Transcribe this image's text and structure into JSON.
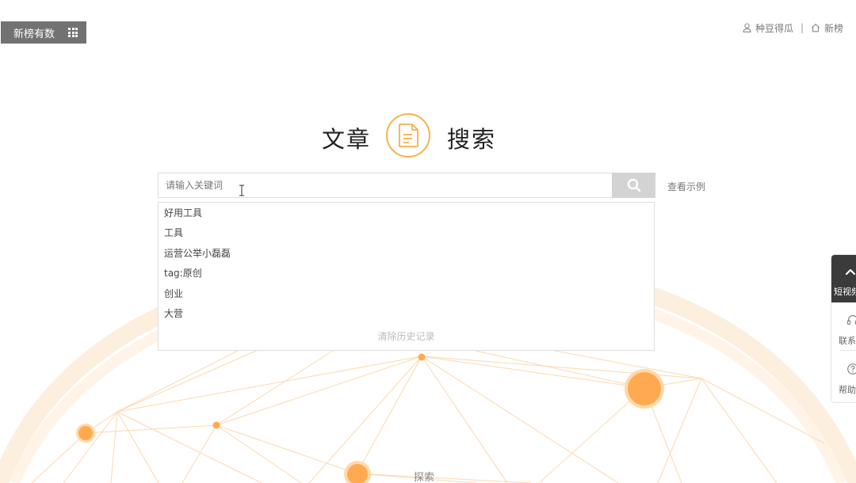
{
  "brand": {
    "label": "新榜有数"
  },
  "topnav": {
    "user_label": "种豆得瓜",
    "home_label": "新榜"
  },
  "title": {
    "left": "文章",
    "right": "搜索"
  },
  "search": {
    "placeholder": "请输入关键词",
    "value": "",
    "example_label": "查看示例"
  },
  "suggestions": {
    "items": [
      "好用工具",
      "工具",
      "运营公举小磊磊",
      "tag:原创",
      "创业",
      "大营"
    ],
    "clear_label": "清除历史记录"
  },
  "bottom": {
    "label": "探索"
  },
  "sidepanel": {
    "top_label": "短视频",
    "contact_label": "联系",
    "help_label": "帮助"
  },
  "colors": {
    "accent": "#f6b14f",
    "node": "#ffaa50",
    "line": "#fbd9b0",
    "brand_bg": "#727272",
    "search_btn": "#d3d3d3"
  },
  "icons": {
    "brand": "grid-icon",
    "user": "user-icon",
    "home": "home-icon",
    "title": "document-icon",
    "search": "search-icon",
    "panel_top": "chevron-up-icon",
    "contact": "headset-icon",
    "help": "help-icon"
  }
}
